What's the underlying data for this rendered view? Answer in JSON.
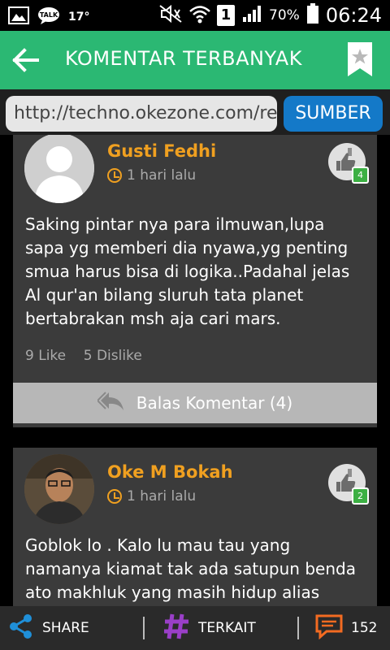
{
  "status_bar": {
    "temperature": "17°",
    "battery_percent": "70%",
    "time": "06:24",
    "sim_indicator": "1"
  },
  "app_bar": {
    "title": "KOMENTAR TERBANYAK"
  },
  "url_bar": {
    "url": "http://techno.okezone.com/rea",
    "button_label": "SUMBER"
  },
  "comments": [
    {
      "author": "Gusti Fedhi",
      "time": "1 hari lalu",
      "body": "Saking pintar nya para ilmuwan,lupa sapa yg memberi dia nyawa,yg penting smua harus bisa di logika..Padahal jelas Al qur'an bilang sluruh tata planet bertabrakan msh aja cari mars.",
      "likes": "9 Like",
      "dislikes": "5 Dislike",
      "vote_badge": "4",
      "reply_label": "Balas Komentar (4)"
    },
    {
      "author": "Oke M Bokah",
      "time": "1 hari lalu",
      "body": "Goblok lo . Kalo lu mau tau yang namanya kiamat tak ada satupun benda ato makhluk yang masih hidup alias",
      "vote_badge": "2"
    }
  ],
  "bottom_bar": {
    "share_label": "SHARE",
    "related_label": "TERKAIT",
    "comment_count": "152"
  },
  "colors": {
    "accent": "#2bb873",
    "author": "#f0a020",
    "button_blue": "#1479c8",
    "badge_green": "#3cb043"
  }
}
